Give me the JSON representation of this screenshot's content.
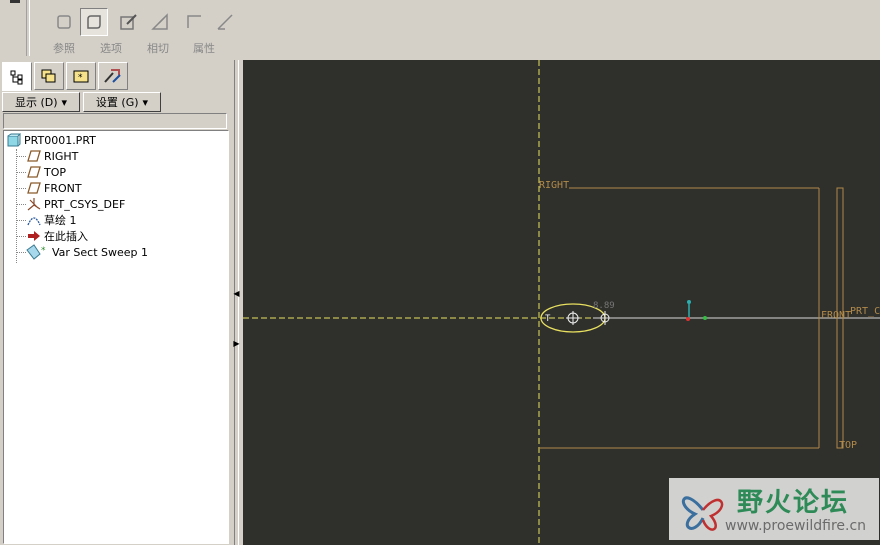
{
  "toolbar": {
    "buttons": [
      {
        "label": "参照",
        "icon": "reference-icon"
      },
      {
        "label": "选项",
        "icon": "options-icon",
        "pressed": true
      },
      {
        "label": "相切",
        "icon": "tangent-icon"
      },
      {
        "label": "属性",
        "icon": "properties-icon"
      }
    ]
  },
  "panel": {
    "tabs": [
      "model-tree-icon",
      "layers-icon",
      "favorites-icon",
      "tools-icon"
    ],
    "display_label": "显示 (D)",
    "settings_label": "设置 (G)",
    "tree": [
      {
        "label": "PRT0001.PRT",
        "icon": "part-icon"
      },
      {
        "label": "RIGHT",
        "icon": "datum-plane-icon"
      },
      {
        "label": "TOP",
        "icon": "datum-plane-icon"
      },
      {
        "label": "FRONT",
        "icon": "datum-plane-icon"
      },
      {
        "label": "PRT_CSYS_DEF",
        "icon": "csys-icon"
      },
      {
        "label": "草绘 1",
        "icon": "sketch-icon"
      },
      {
        "label": "在此插入",
        "icon": "insert-here-arrow-icon"
      },
      {
        "label": "Var Sect Sweep 1",
        "icon": "var-sect-sweep-icon"
      }
    ]
  },
  "viewport": {
    "labels": {
      "right": "RIGHT",
      "top": "TOP",
      "front": "FRONT",
      "csys": "PRT_C",
      "dim": "8.89",
      "start": "T"
    },
    "colors": {
      "background": "#2f2f2b",
      "datum": "#b08a4a",
      "axis": "#e8e060"
    }
  },
  "watermark": {
    "title": "野火论坛",
    "url": "www.proewildfire.cn"
  }
}
